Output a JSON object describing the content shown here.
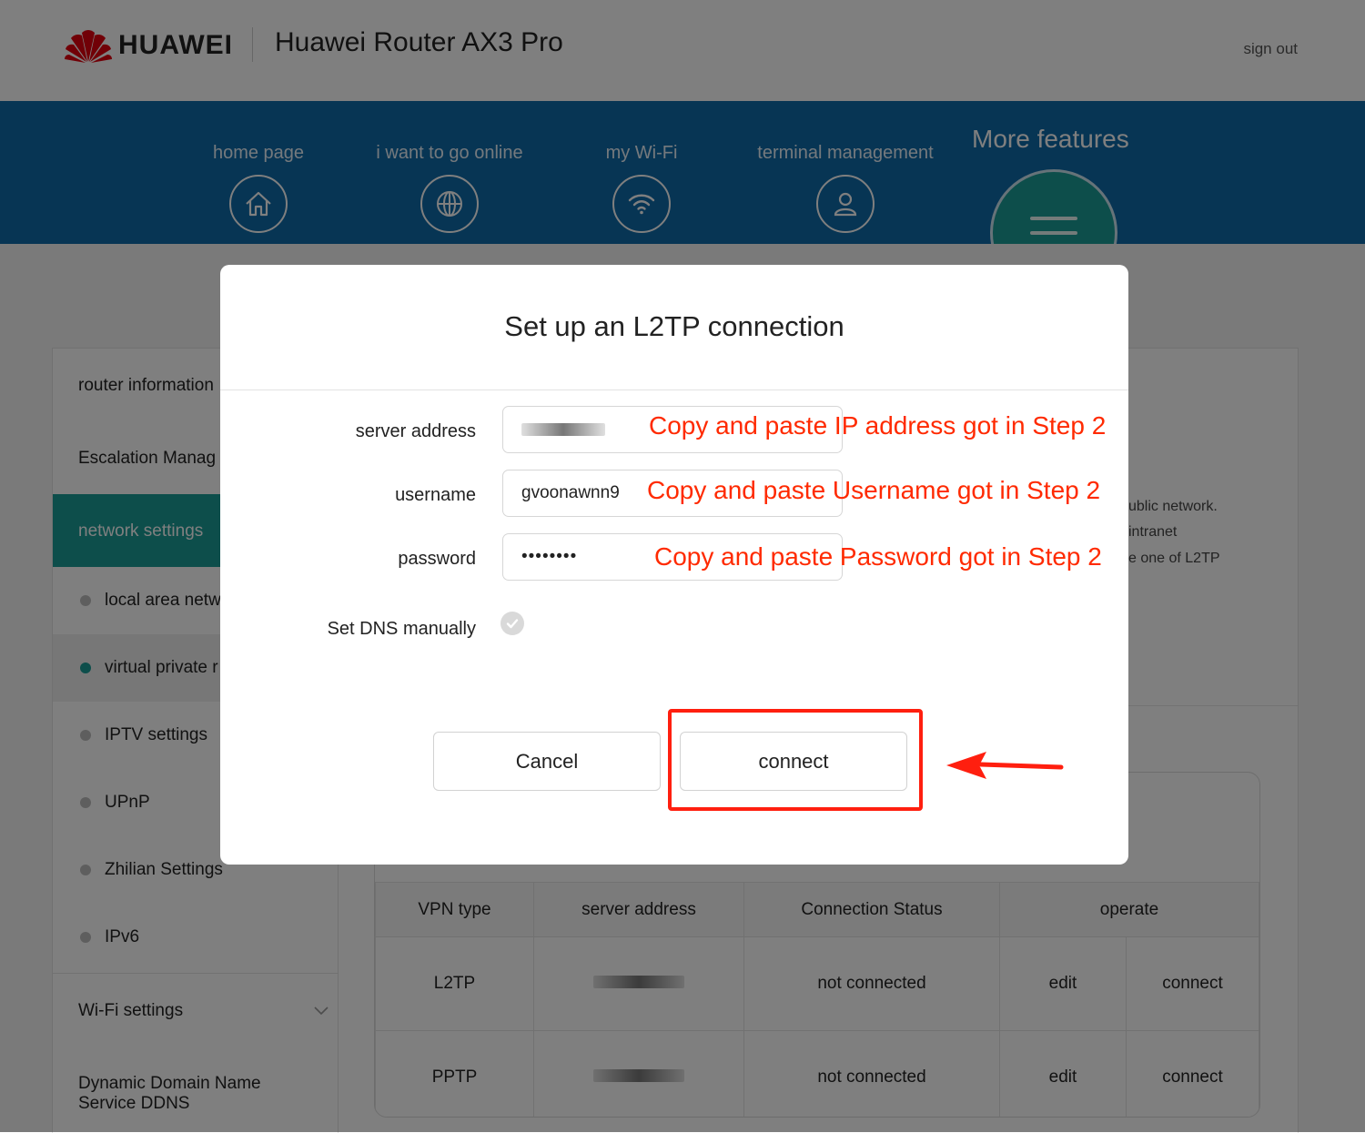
{
  "header": {
    "brand": "HUAWEI",
    "product": "Huawei Router AX3 Pro",
    "sign_out": "sign out"
  },
  "nav": {
    "items": [
      {
        "label": "home page",
        "icon": "home-icon"
      },
      {
        "label": "i want to go online",
        "icon": "globe-icon"
      },
      {
        "label": "my Wi-Fi",
        "icon": "wifi-icon"
      },
      {
        "label": "terminal management",
        "icon": "user-icon"
      }
    ],
    "more": {
      "label": "More features",
      "icon": "menu-icon"
    }
  },
  "sidebar": {
    "router_information": "router information",
    "escalation": "Escalation Manag",
    "network_settings": "network settings",
    "sub": [
      {
        "label": "local area netw"
      },
      {
        "label": "virtual private r"
      },
      {
        "label": "IPTV settings"
      },
      {
        "label": "UPnP"
      },
      {
        "label": "Zhilian Settings"
      },
      {
        "label": "IPv6"
      }
    ],
    "wifi_settings": "Wi-Fi settings",
    "ddns_line1": "Dynamic Domain Name",
    "ddns_line2": "Service DDNS"
  },
  "main": {
    "description": [
      "ublic network.",
      "intranet",
      "e one of L2TP"
    ],
    "table": {
      "headers": [
        "VPN type",
        "server address",
        "Connection Status",
        "operate"
      ],
      "rows": [
        {
          "type": "L2TP",
          "status": "not connected",
          "edit": "edit",
          "connect": "connect"
        },
        {
          "type": "PPTP",
          "status": "not connected",
          "edit": "edit",
          "connect": "connect"
        }
      ]
    }
  },
  "modal": {
    "title": "Set up an L2TP connection",
    "fields": {
      "server_address_label": "server address",
      "username_label": "username",
      "username_value": "gvoonawnn9",
      "password_label": "password",
      "password_value": "••••••••",
      "dns_label": "Set DNS manually"
    },
    "annotations": {
      "server": "Copy and paste IP address got in Step 2",
      "username": "Copy and paste Username got in Step 2",
      "password": "Copy and paste Password got in Step 2"
    },
    "cancel": "Cancel",
    "connect": "connect"
  },
  "colors": {
    "nav_band": "#0f6aa8",
    "accent_teal": "#1a9c96",
    "annotation_red": "#ff2a00"
  }
}
